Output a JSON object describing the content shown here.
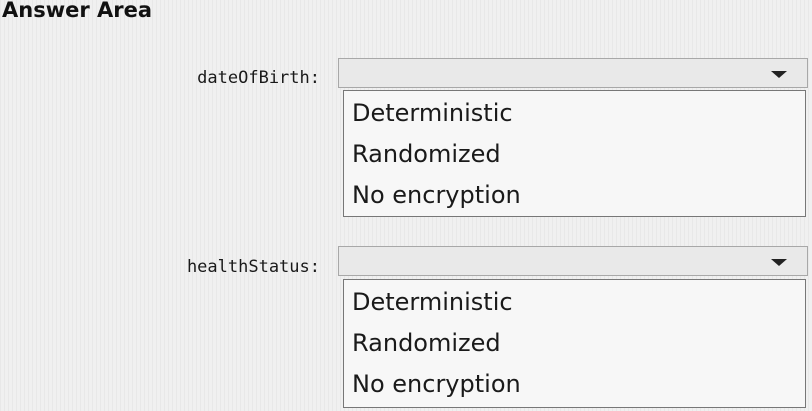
{
  "title": "Answer Area",
  "rows": [
    {
      "label": "dateOfBirth:",
      "options": [
        "Deterministic",
        "Randomized",
        "No encryption"
      ]
    },
    {
      "label": "healthStatus:",
      "options": [
        "Deterministic",
        "Randomized",
        "No encryption"
      ]
    }
  ]
}
